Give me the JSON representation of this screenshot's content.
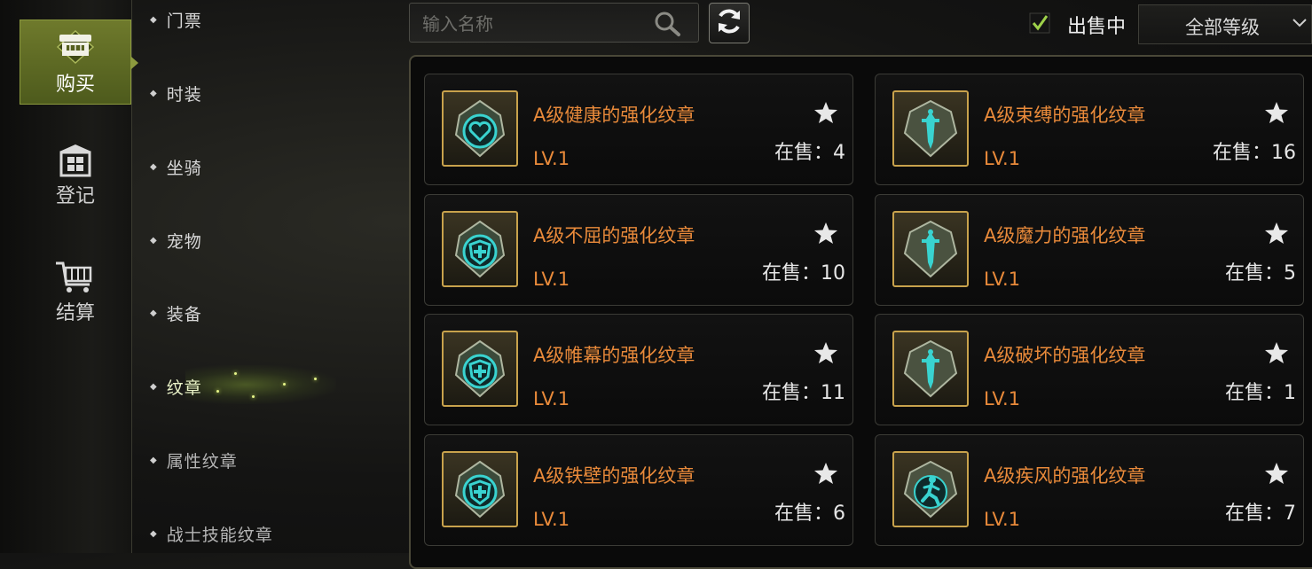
{
  "nav": [
    {
      "label": "购买",
      "icon": "shop-icon",
      "active": true
    },
    {
      "label": "登记",
      "icon": "register-icon",
      "active": false
    },
    {
      "label": "结算",
      "icon": "cart-icon",
      "active": false
    }
  ],
  "categories": [
    {
      "label": "门票"
    },
    {
      "label": "时装"
    },
    {
      "label": "坐骑"
    },
    {
      "label": "宠物"
    },
    {
      "label": "装备"
    },
    {
      "label": "纹章",
      "selected": true
    },
    {
      "label": "属性纹章"
    },
    {
      "label": "战士技能纹章"
    }
  ],
  "search": {
    "placeholder": "输入名称",
    "value": ""
  },
  "filters": {
    "on_sale_label": "出售中",
    "on_sale_checked": true,
    "level_select": "全部等级"
  },
  "colors": {
    "accent": "#6f7a2c",
    "item_name": "#e98a3a",
    "frame_gold": "#c8a24c",
    "emblem_cyan": "#39d3d0"
  },
  "items": [
    {
      "name": "A级健康的强化纹章",
      "level": "LV.1",
      "stock": "在售：4",
      "emblem": "heart-emblem-icon"
    },
    {
      "name": "A级束缚的强化纹章",
      "level": "LV.1",
      "stock": "在售：16",
      "emblem": "sword-emblem-icon"
    },
    {
      "name": "A级不屈的强化纹章",
      "level": "LV.1",
      "stock": "在售：10",
      "emblem": "shield-emblem-icon"
    },
    {
      "name": "A级魔力的强化纹章",
      "level": "LV.1",
      "stock": "在售：5",
      "emblem": "sword-emblem-icon"
    },
    {
      "name": "A级帷幕的强化纹章",
      "level": "LV.1",
      "stock": "在售：11",
      "emblem": "shield-emblem-icon"
    },
    {
      "name": "A级破坏的强化纹章",
      "level": "LV.1",
      "stock": "在售：1",
      "emblem": "sword-emblem-icon"
    },
    {
      "name": "A级铁壁的强化纹章",
      "level": "LV.1",
      "stock": "在售：6",
      "emblem": "shield-emblem-icon"
    },
    {
      "name": "A级疾风的强化纹章",
      "level": "LV.1",
      "stock": "在售：7",
      "emblem": "runner-emblem-icon"
    }
  ]
}
